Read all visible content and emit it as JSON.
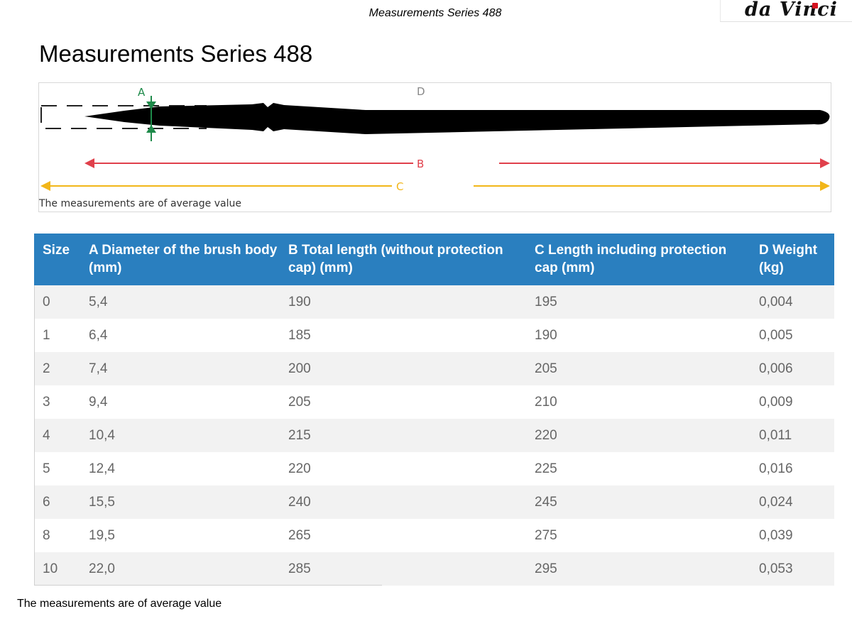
{
  "header": {
    "title": "Measurements Series 488",
    "logo": "da Vinci"
  },
  "page_title": "Measurements Series 488",
  "diagram": {
    "labels": {
      "a": "A",
      "b": "B",
      "c": "C",
      "d": "D"
    },
    "note": "The measurements are of average value",
    "colors": {
      "a": "#1e8a4a",
      "b": "#e0404b",
      "c": "#f2b619",
      "d": "#888888"
    }
  },
  "table": {
    "columns": [
      "Size",
      "A Diameter of the brush body (mm)",
      "B Total length (without protection cap) (mm)",
      "C Length including protection cap (mm)",
      "D Weight (kg)"
    ],
    "rows": [
      [
        "0",
        "5,4",
        "190",
        "195",
        "0,004"
      ],
      [
        "1",
        "6,4",
        "185",
        "190",
        "0,005"
      ],
      [
        "2",
        "7,4",
        "200",
        "205",
        "0,006"
      ],
      [
        "3",
        "9,4",
        "205",
        "210",
        "0,009"
      ],
      [
        "4",
        "10,4",
        "215",
        "220",
        "0,011"
      ],
      [
        "5",
        "12,4",
        "220",
        "225",
        "0,016"
      ],
      [
        "6",
        "15,5",
        "240",
        "245",
        "0,024"
      ],
      [
        "8",
        "19,5",
        "265",
        "275",
        "0,039"
      ],
      [
        "10",
        "22,0",
        "285",
        "295",
        "0,053"
      ]
    ],
    "header_color": "#2a7fbf"
  },
  "footnote": "The measurements are of average value"
}
